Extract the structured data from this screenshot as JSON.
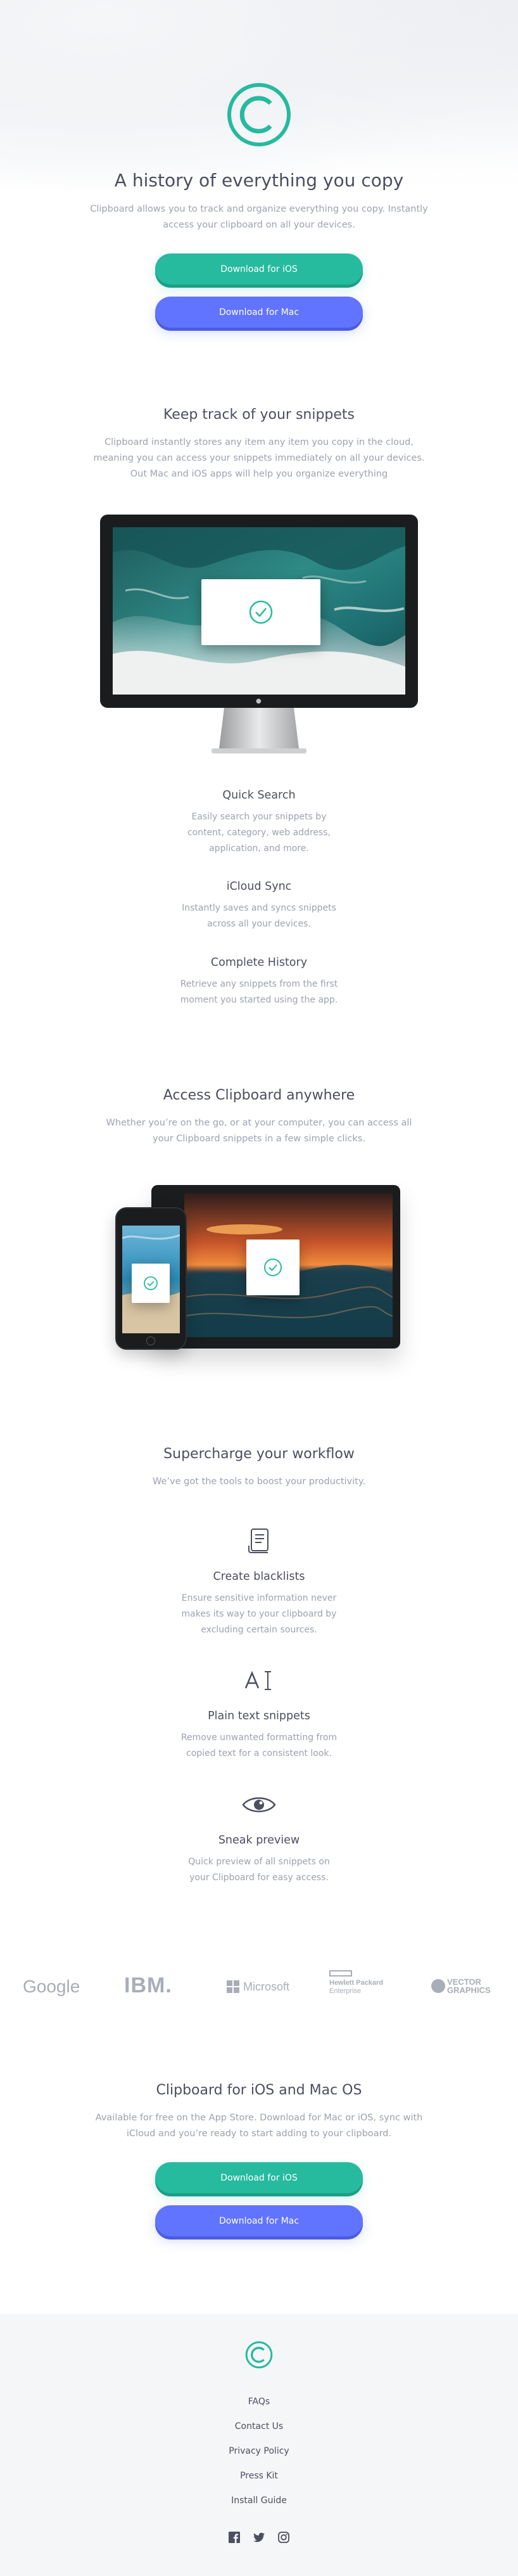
{
  "colors": {
    "primary_teal": "#26ba9f",
    "accent_blue": "#6174ff",
    "heading": "#4c4e61",
    "body_text": "#9da2b0",
    "footer_bg": "#f5f6f8"
  },
  "hero": {
    "logo_icon": "copyright-logo-icon",
    "title": "A history of everything you copy",
    "text": "Clipboard allows you to track and organize everything you copy. Instantly access your clipboard on all your devices.",
    "ios_button": "Download for iOS",
    "mac_button": "Download for Mac"
  },
  "snippets": {
    "title": "Keep track of your snippets",
    "text": "Clipboard instantly stores any item any item you copy in the cloud, meaning you can access your snippets immediately on all your devices. Out Mac and iOS apps will help you organize everything",
    "features": [
      {
        "title": "Quick Search",
        "text": "Easily search your snippets by content, category, web address, application, and more."
      },
      {
        "title": "iCloud Sync",
        "text": "Instantly saves and syncs snippets across all your devices."
      },
      {
        "title": "Complete History",
        "text": "Retrieve any snippets from the first moment you started using the app."
      }
    ]
  },
  "access": {
    "title": "Access Clipboard anywhere",
    "text": "Whether you’re on the go, or at your computer, you can access all your Clipboard snippets in a few simple clicks."
  },
  "workflow": {
    "title": "Supercharge your workflow",
    "text": "We’ve got the tools to boost your productivity.",
    "features": [
      {
        "icon": "blacklist-document-icon",
        "title": "Create blacklists",
        "text": "Ensure sensitive information never makes its way to your clipboard by excluding certain sources."
      },
      {
        "icon": "text-cursor-icon",
        "title": "Plain text snippets",
        "text": "Remove unwanted formatting from copied text for a consistent look."
      },
      {
        "icon": "eye-icon",
        "title": "Sneak preview",
        "text": "Quick preview of all snippets on your Clipboard for easy access."
      }
    ]
  },
  "brands": {
    "google": "Google",
    "ibm": "IBM.",
    "microsoft": "Microsoft",
    "hp_line1": "Hewlett Packard",
    "hp_line2": "Enterprise",
    "vector_line1": "VECTOR",
    "vector_line2": "GRAPHICS"
  },
  "cta": {
    "title": "Clipboard for iOS and Mac OS",
    "text": "Available for free on the App Store. Download for Mac or iOS, sync with iCloud and you’re ready to start adding to your clipboard.",
    "ios_button": "Download for iOS",
    "mac_button": "Download for Mac"
  },
  "footer": {
    "logo_icon": "copyright-logo-icon",
    "links": [
      "FAQs",
      "Contact Us",
      "Privacy Policy",
      "Press Kit",
      "Install Guide"
    ],
    "social_icons": [
      "facebook-icon",
      "twitter-icon",
      "instagram-icon"
    ]
  }
}
